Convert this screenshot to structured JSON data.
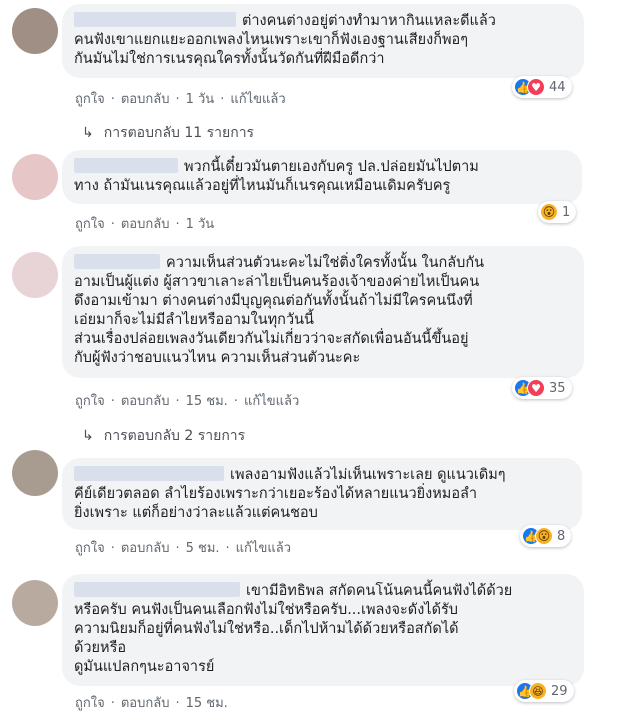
{
  "comments": [
    {
      "text": "ต่างคนต่างอยู่ต่างทำมาหากินแหละดีแล้ว\nคนฟังเขาแยกแยะออกเพลงไหนเพราะเขาก็ฟังเองฐานเสียงก็พอๆ\nกันมันไม่ใช่การเนรคุณใครทั้งนั้นวัดกันที่ฝีมือดีกว่า",
      "reactions": [
        "like-icon",
        "love-icon"
      ],
      "reaction_count": "44",
      "actions": [
        "ถูกใจ",
        "ตอบกลับ",
        "1 วัน",
        "แก้ไขแล้ว"
      ],
      "replies_label": "การตอบกลับ 11 รายการ",
      "avatar_color": "#9f8f84"
    },
    {
      "text": "พวกนี้เดี๋ยวมันตายเองกับครู ปล.ปล่อยมันไปตาม\nทาง ถ้ามันเนรคุณแล้วอยู่ที่ไหนมันก็เนรคุณเหมือนเดิมครับครู",
      "reactions": [
        "wow-icon"
      ],
      "reaction_count": "1",
      "actions": [
        "ถูกใจ",
        "ตอบกลับ",
        "1 วัน"
      ],
      "replies_label": "",
      "avatar_color": "#e6c6c7"
    },
    {
      "text": "ความเห็นส่วนตัวนะคะไม่ใช่ติ่งใครทั้งนั้น ในกลับกัน\nอามเป็นผู้แต่ง ผู้สาวขาเลาะล่าไยเป็นคนร้องเจ้าของค่ายไหเป็นคน\nดึงอามเข้ามา ต่างคนต่างมีบุญคุณต่อกันทั้งนั้นถ้าไม่มีใครคนนึงที่\nเอ่ยมาก็จะไม่มีลำไยหรืออามในทุกวันนี้\nส่วนเรื่องปล่อยเพลงวันเดียวกันไม่เกี่ยวว่าจะสกัดเพื่อนอันนี้ขึ้นอยู่\nกับผู้ฟังว่าชอบแนวไหน ความเห็นส่วนตัวนะคะ",
      "reactions": [
        "like-icon",
        "love-icon"
      ],
      "reaction_count": "35",
      "actions": [
        "ถูกใจ",
        "ตอบกลับ",
        "15 ชม.",
        "แก้ไขแล้ว"
      ],
      "replies_label": "การตอบกลับ 2 รายการ",
      "avatar_color": "#e8d4d6"
    },
    {
      "text": "เพลงอามฟังแล้วไม่เห็นเพราะเลย ดูแนวเดิมๆ\nคีย์เดียวตลอด ลำไยร้องเพราะกว่าเยอะร้องได้หลายแนวยิ่งหมอลำ\nยิ่งเพราะ แต่ก็อย่างว่าละแล้วแต่คนชอบ",
      "reactions": [
        "like-icon",
        "wow-icon"
      ],
      "reaction_count": "8",
      "actions": [
        "ถูกใจ",
        "ตอบกลับ",
        "5 ชม.",
        "แก้ไขแล้ว"
      ],
      "replies_label": "",
      "avatar_color": "#a89c90"
    },
    {
      "text": "เขามีอิทธิพล สกัดคนโน้นคนนี้คนฟังได้ด้วย\nหรือครับ คนฟังเป็นคนเลือกฟังไม่ใช่หรือครับ...เพลงจะดังได้รับ\nความนิยมก็อยู่ที่คนฟังไม่ใช่หรือ..เด็กไปห้ามได้ด้วยหรือสกัดได้\nด้วยหรือ\nดูมันแปลกๆนะอาจารย์",
      "reactions": [
        "like-icon",
        "haha-icon"
      ],
      "reaction_count": "29",
      "actions": [
        "ถูกใจ",
        "ตอบกลับ",
        "15 ชม."
      ],
      "replies_label": "",
      "avatar_color": "#b9aaa0"
    }
  ]
}
